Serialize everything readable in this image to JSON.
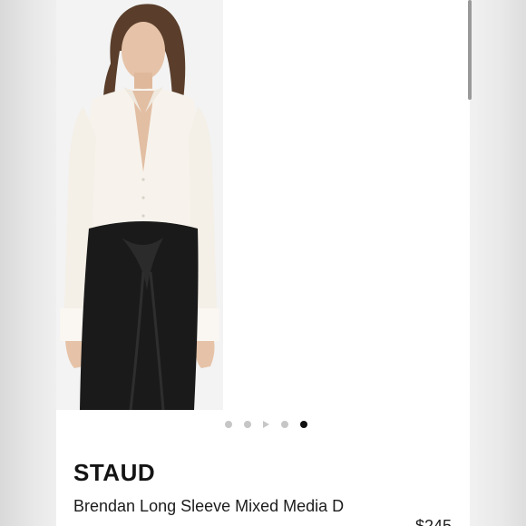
{
  "product": {
    "brand": "STAUD",
    "title": "Brendan Long Sleeve Mixed Media D",
    "price": "$245"
  },
  "carousel": {
    "slide_count": 5,
    "active_index": 4
  },
  "colors": {
    "shirt": "#f7f3ec",
    "skirt": "#1a1a1a",
    "page_background": "#ffffff",
    "side_background": "#e4e4e4"
  }
}
